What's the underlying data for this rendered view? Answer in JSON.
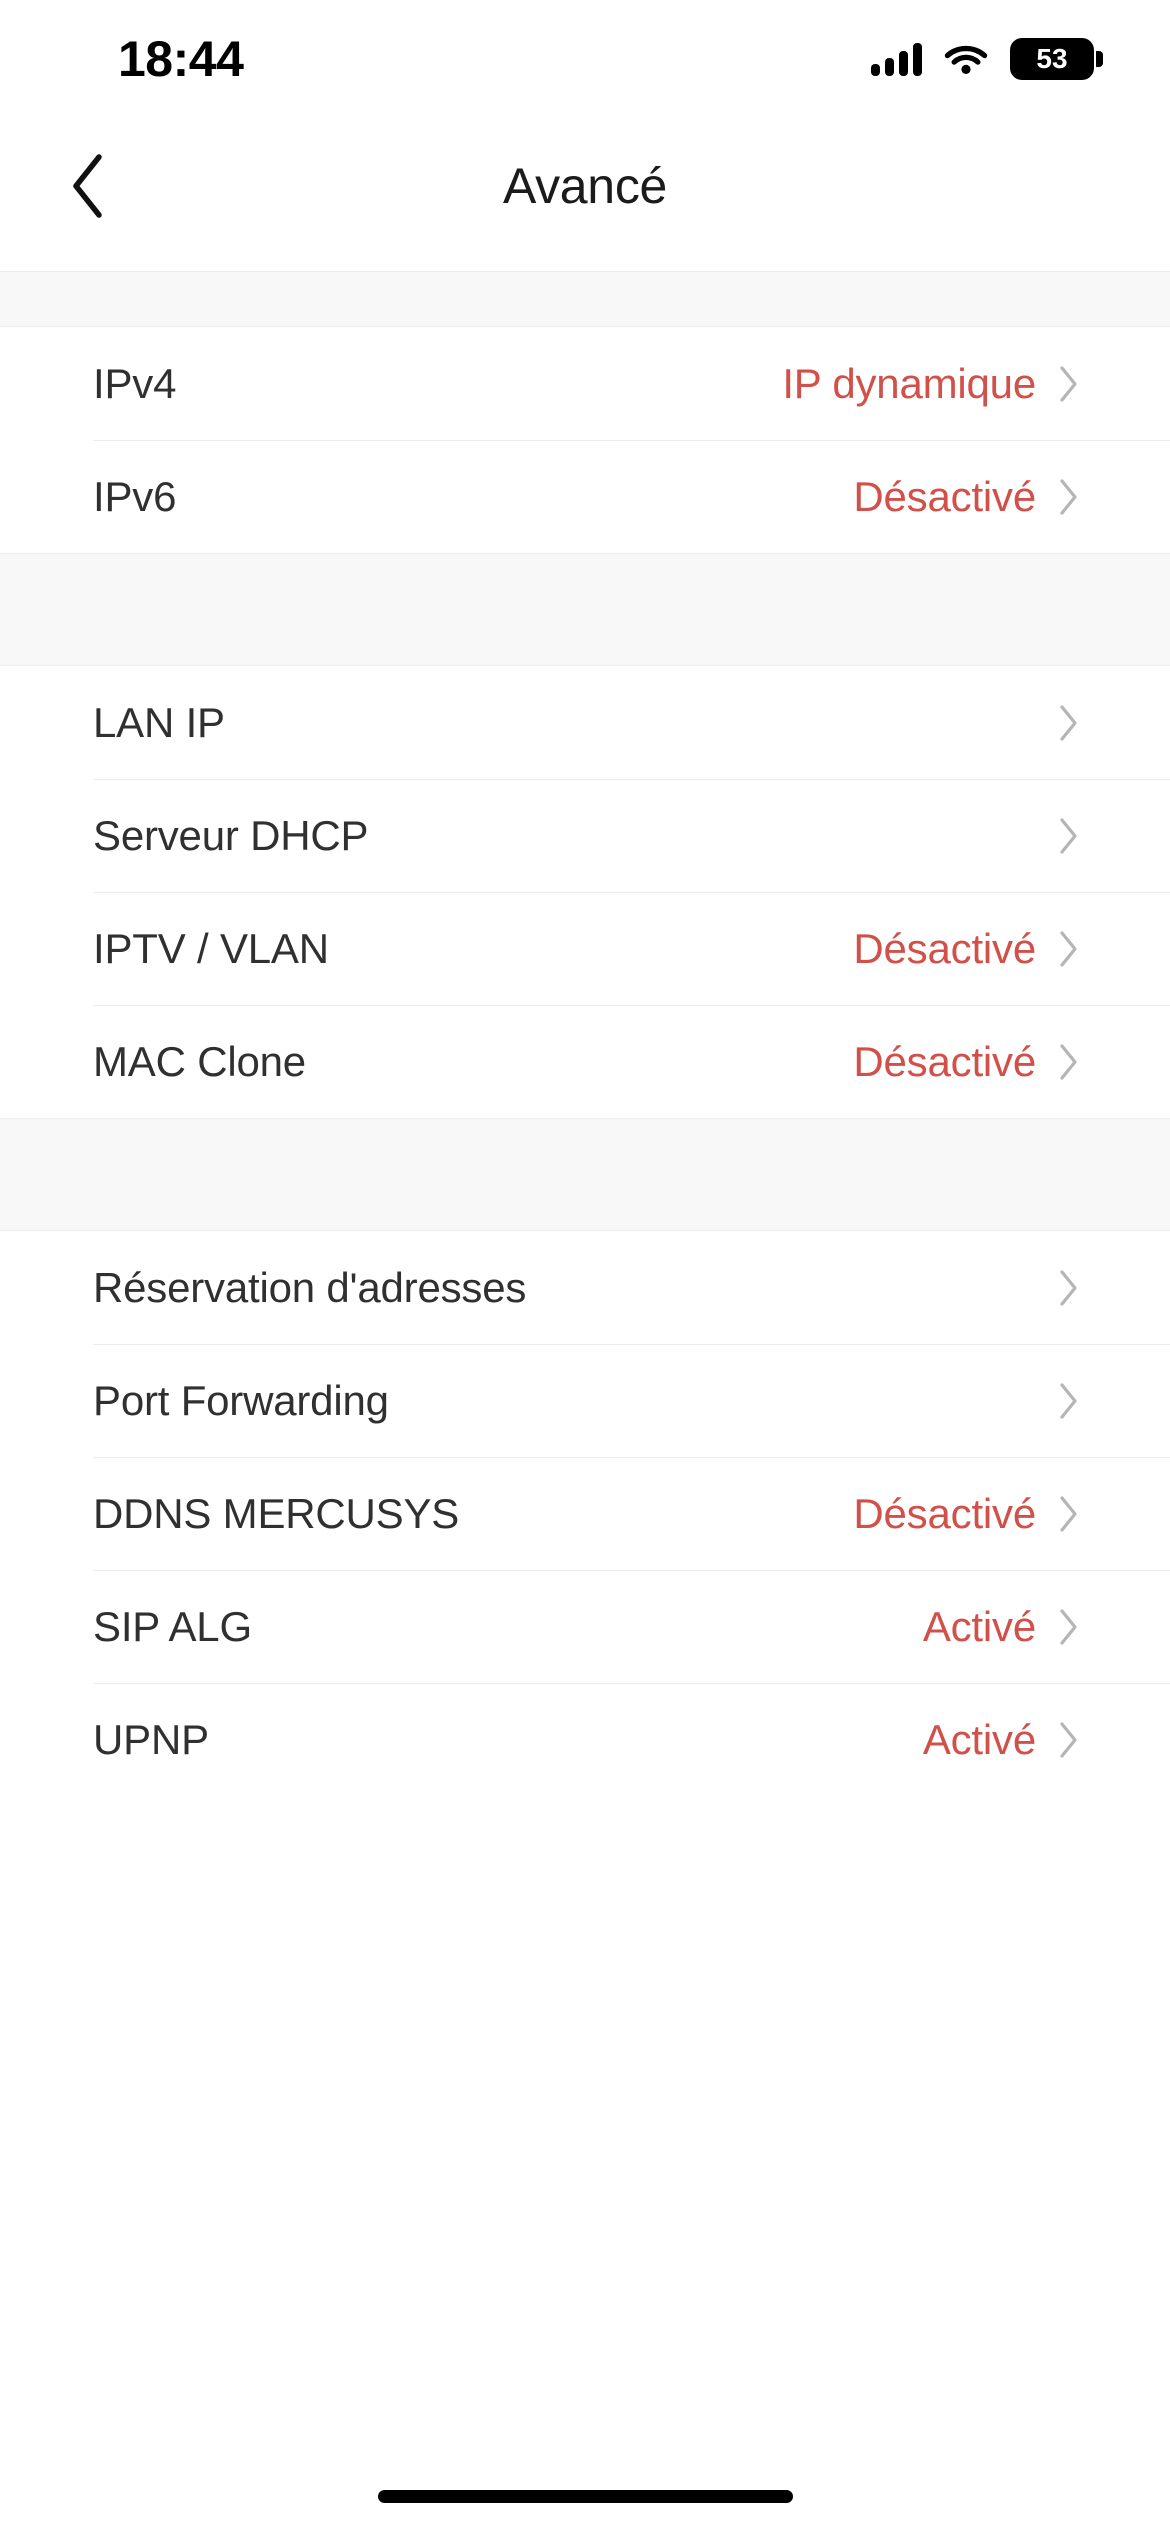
{
  "status_bar": {
    "time": "18:44",
    "signal_icon": "cellular-signal-icon",
    "wifi_icon": "wifi-icon",
    "battery_level": "53"
  },
  "nav": {
    "back_icon": "chevron-left-icon",
    "title": "Avancé"
  },
  "colors": {
    "value_red": "#d2504a",
    "label_dark": "#303030",
    "separator": "#ececec",
    "group_gap_bg": "#f8f8f8",
    "chevron_gray": "#b5b5b5"
  },
  "groups": [
    {
      "name": "internet-settings-group",
      "rows": [
        {
          "label": "IPv4",
          "value": "IP dynamique",
          "chevron": "chevron-right-icon"
        },
        {
          "label": "IPv6",
          "value": "Désactivé",
          "chevron": "chevron-right-icon"
        }
      ]
    },
    {
      "name": "network-settings-group",
      "rows": [
        {
          "label": "LAN IP",
          "value": "",
          "chevron": "chevron-right-icon"
        },
        {
          "label": "Serveur DHCP",
          "value": "",
          "chevron": "chevron-right-icon"
        },
        {
          "label": "IPTV / VLAN",
          "value": "Désactivé",
          "chevron": "chevron-right-icon"
        },
        {
          "label": "MAC Clone",
          "value": "Désactivé",
          "chevron": "chevron-right-icon"
        }
      ]
    },
    {
      "name": "advanced-services-group",
      "rows": [
        {
          "label": "Réservation d'adresses",
          "value": "",
          "chevron": "chevron-right-icon"
        },
        {
          "label": "Port Forwarding",
          "value": "",
          "chevron": "chevron-right-icon"
        },
        {
          "label": "DDNS MERCUSYS",
          "value": "Désactivé",
          "chevron": "chevron-right-icon"
        },
        {
          "label": "SIP ALG",
          "value": "Activé",
          "chevron": "chevron-right-icon"
        },
        {
          "label": "UPNP",
          "value": "Activé",
          "chevron": "chevron-right-icon"
        }
      ]
    }
  ],
  "home_indicator": "home-indicator"
}
